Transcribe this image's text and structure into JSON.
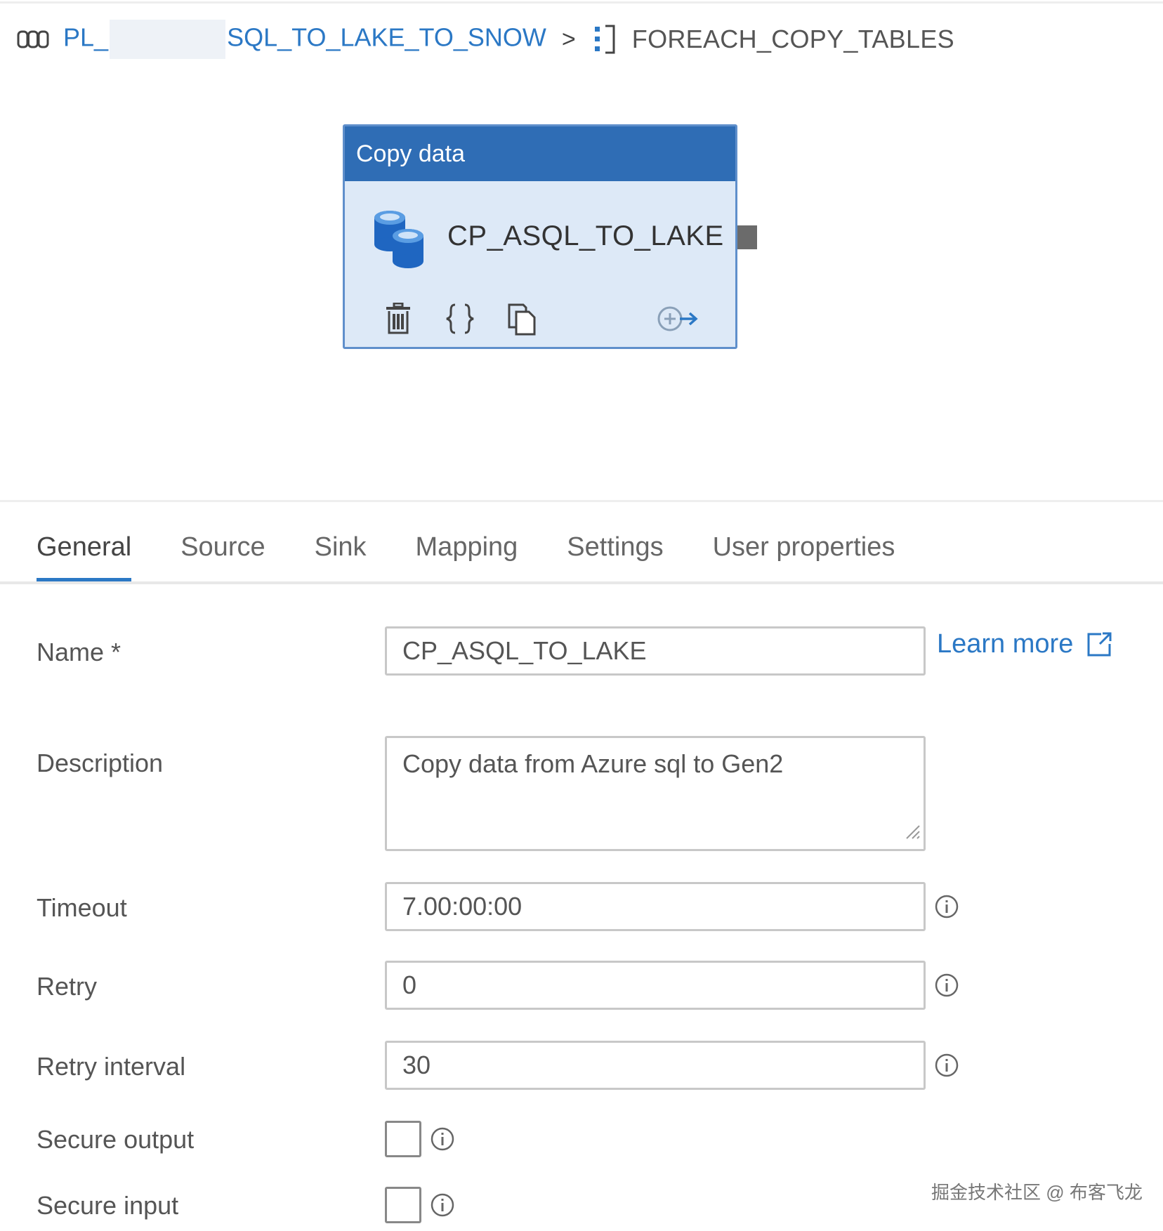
{
  "breadcrumb": {
    "pipeline_prefix": "PL_",
    "pipeline_suffix": "SQL_TO_LAKE_TO_SNOW",
    "separator": ">",
    "current": "FOREACH_COPY_TABLES"
  },
  "activity": {
    "type_label": "Copy data",
    "name": "CP_ASQL_TO_LAKE"
  },
  "tabs": [
    {
      "label": "General",
      "active": true
    },
    {
      "label": "Source",
      "active": false
    },
    {
      "label": "Sink",
      "active": false
    },
    {
      "label": "Mapping",
      "active": false
    },
    {
      "label": "Settings",
      "active": false
    },
    {
      "label": "User properties",
      "active": false
    }
  ],
  "form": {
    "name_label": "Name",
    "required_marker": "*",
    "name_value": "CP_ASQL_TO_LAKE",
    "learn_more": "Learn more",
    "description_label": "Description",
    "description_value": "Copy data from Azure sql to Gen2",
    "timeout_label": "Timeout",
    "timeout_value": "7.00:00:00",
    "retry_label": "Retry",
    "retry_value": "0",
    "retry_interval_label": "Retry interval",
    "retry_interval_value": "30",
    "secure_output_label": "Secure output",
    "secure_output_checked": false,
    "secure_input_label": "Secure input",
    "secure_input_checked": false
  },
  "watermark": "掘金技术社区 @ 布客飞龙",
  "colors": {
    "accent": "#2b78c5",
    "card_header": "#2f6db5",
    "card_body": "#dde9f7"
  }
}
